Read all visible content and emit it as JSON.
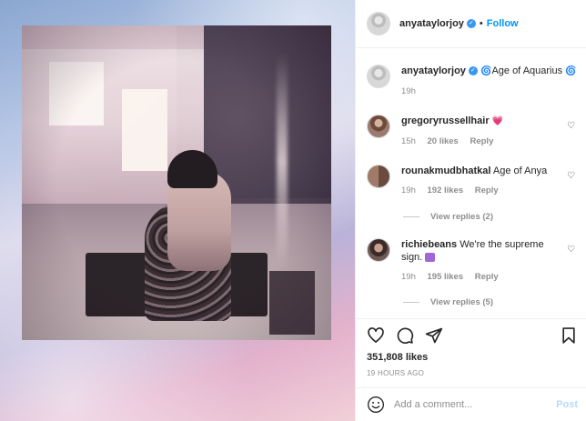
{
  "header": {
    "username": "anyataylorjoy",
    "separator": "•",
    "follow_label": "Follow"
  },
  "caption": {
    "username": "anyataylorjoy",
    "text": "Age of Aquarius",
    "time": "19h"
  },
  "comments": [
    {
      "username": "gregoryrussellhair",
      "text": "",
      "time": "15h",
      "likes": "20 likes",
      "reply_label": "Reply"
    },
    {
      "username": "rounakmudbhatkal",
      "text": "Age of Anya",
      "time": "19h",
      "likes": "192 likes",
      "reply_label": "Reply",
      "view_replies": "View replies (2)"
    },
    {
      "username": "richiebeans",
      "text": "We're the supreme",
      "text_line2": "sign.",
      "time": "19h",
      "likes": "195 likes",
      "reply_label": "Reply",
      "view_replies": "View replies (5)"
    }
  ],
  "actions": {
    "likes": "351,808 likes",
    "timestamp": "19 HOURS AGO"
  },
  "add_comment": {
    "placeholder": "Add a comment...",
    "post_label": "Post"
  },
  "colors": {
    "accent": "#0095f6",
    "verified": "#3897f0",
    "muted": "#8e8e8e"
  }
}
